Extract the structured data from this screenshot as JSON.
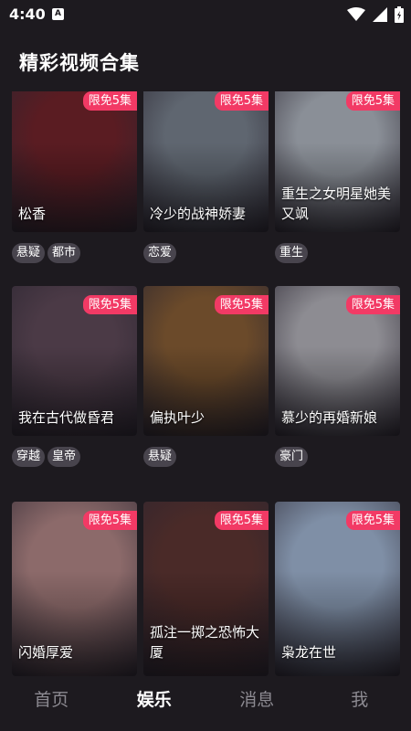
{
  "status_bar": {
    "time": "4:40",
    "notification_letter": "A"
  },
  "page": {
    "title": "精彩视频合集"
  },
  "cards": [
    {
      "title": "松香",
      "badge": "限免5集",
      "tags": [
        "悬疑",
        "都市"
      ],
      "color": "#5a1c22"
    },
    {
      "title": "冷少的战神娇妻",
      "badge": "限免5集",
      "tags": [
        "恋爱"
      ],
      "color": "#5f6670"
    },
    {
      "title": "重生之女明星她美又飒",
      "badge": "限免5集",
      "tags": [
        "重生"
      ],
      "color": "#8a8f97"
    },
    {
      "title": "我在古代做昏君",
      "badge": "限免5集",
      "tags": [
        "穿越",
        "皇帝"
      ],
      "color": "#4b3a46"
    },
    {
      "title": "偏执叶少",
      "badge": "限免5集",
      "tags": [
        "悬疑"
      ],
      "color": "#6b4a2a"
    },
    {
      "title": "慕少的再婚新娘",
      "badge": "限免5集",
      "tags": [
        "豪门"
      ],
      "color": "#8d8c92"
    },
    {
      "title": "闪婚厚爱",
      "badge": "限免5集",
      "tags": [],
      "color": "#8c6a6a"
    },
    {
      "title": "孤注一掷之恐怖大厦",
      "badge": "限免5集",
      "tags": [],
      "color": "#4a2a28"
    },
    {
      "title": "枭龙在世",
      "badge": "限免5集",
      "tags": [],
      "color": "#7f8fa6"
    }
  ],
  "bottom_nav": [
    {
      "label": "首页",
      "active": false
    },
    {
      "label": "娱乐",
      "active": true
    },
    {
      "label": "消息",
      "active": false
    },
    {
      "label": "我",
      "active": false
    }
  ],
  "colors": {
    "background": "#1d1a1f",
    "badge": "#f23a65",
    "tag": "#48444d",
    "nav_inactive": "#8c8a91"
  }
}
